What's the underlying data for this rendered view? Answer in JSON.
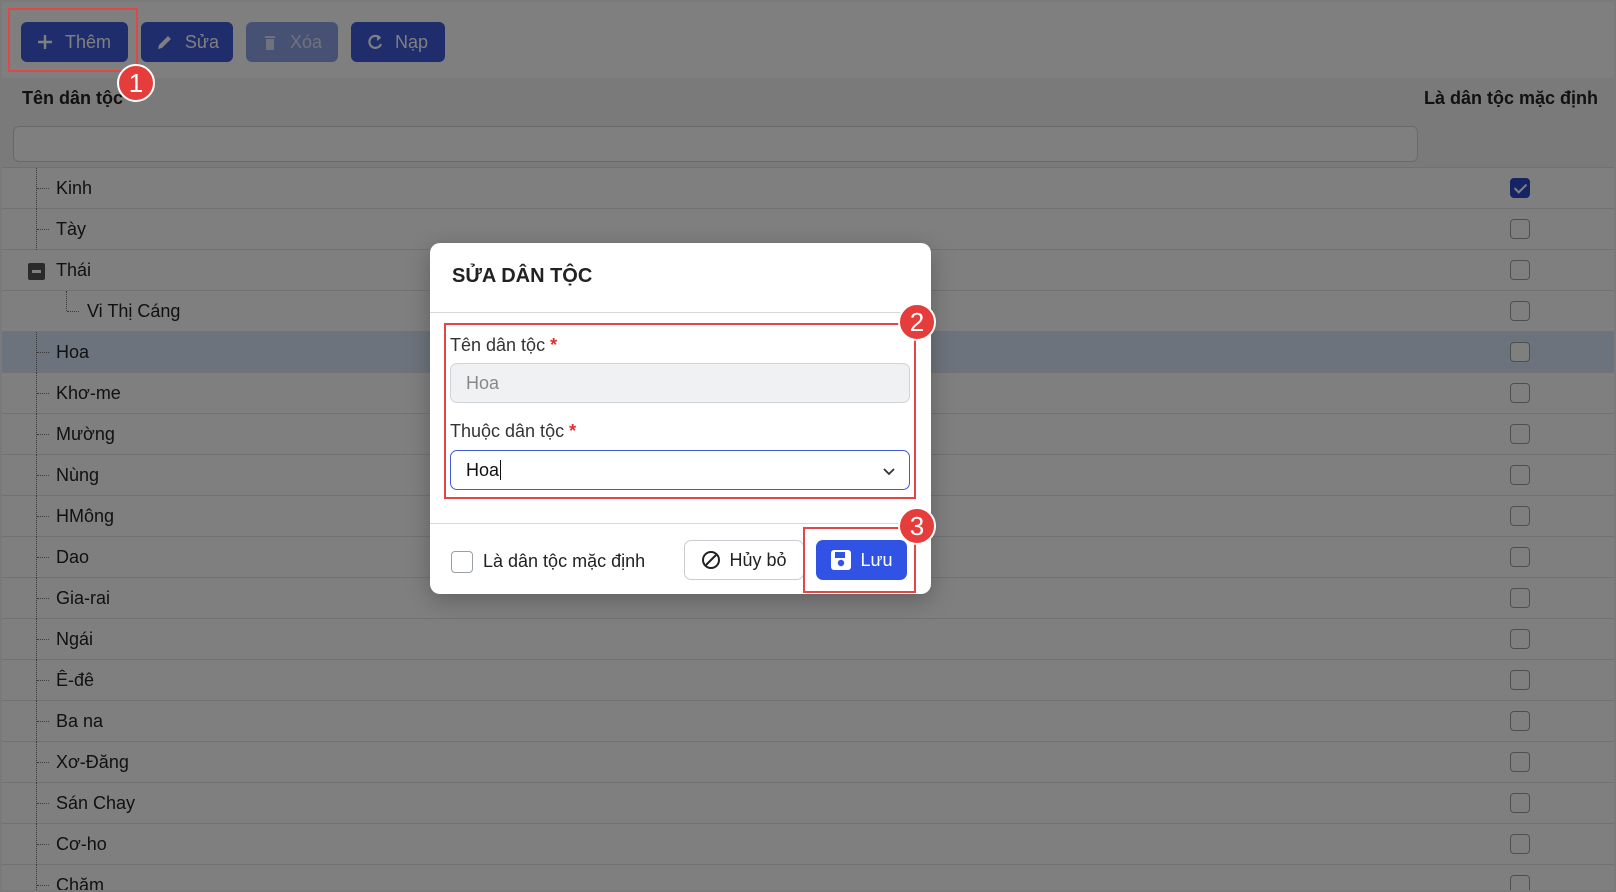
{
  "toolbar": {
    "add_label": "Thêm",
    "edit_label": "Sửa",
    "delete_label": "Xóa",
    "reload_label": "Nạp"
  },
  "grid": {
    "col_name": "Tên dân tộc",
    "col_default": "Là dân tộc mặc định",
    "filter_placeholder": "",
    "rows": [
      {
        "name": "Kinh",
        "checked": true
      },
      {
        "name": "Tày",
        "checked": false
      },
      {
        "name": "Thái",
        "checked": false,
        "expanded": true
      },
      {
        "name": "Vi Thị Cáng",
        "checked": false,
        "child": true
      },
      {
        "name": "Hoa",
        "checked": false,
        "selected": true
      },
      {
        "name": "Khơ-me",
        "checked": false
      },
      {
        "name": "Mường",
        "checked": false
      },
      {
        "name": "Nùng",
        "checked": false
      },
      {
        "name": "HMông",
        "checked": false
      },
      {
        "name": "Dao",
        "checked": false
      },
      {
        "name": "Gia-rai",
        "checked": false
      },
      {
        "name": "Ngái",
        "checked": false
      },
      {
        "name": "Ê-đê",
        "checked": false
      },
      {
        "name": "Ba na",
        "checked": false
      },
      {
        "name": "Xơ-Đăng",
        "checked": false
      },
      {
        "name": "Sán Chay",
        "checked": false
      },
      {
        "name": "Cơ-ho",
        "checked": false
      },
      {
        "name": "Chăm",
        "checked": false
      }
    ]
  },
  "modal": {
    "title": "SỬA DÂN TỘC",
    "name_label": "Tên dân tộc",
    "name_value": "Hoa",
    "parent_label": "Thuộc dân tộc",
    "parent_value": "Hoa",
    "required_mark": "*",
    "default_label": "Là dân tộc mặc định",
    "cancel_label": "Hủy bỏ",
    "save_label": "Lưu"
  },
  "annotations": {
    "step1": "1",
    "step2": "2",
    "step3": "3"
  },
  "colors": {
    "primary": "#3f5bd9",
    "save": "#3153e5",
    "annotation": "#e53c3c"
  }
}
